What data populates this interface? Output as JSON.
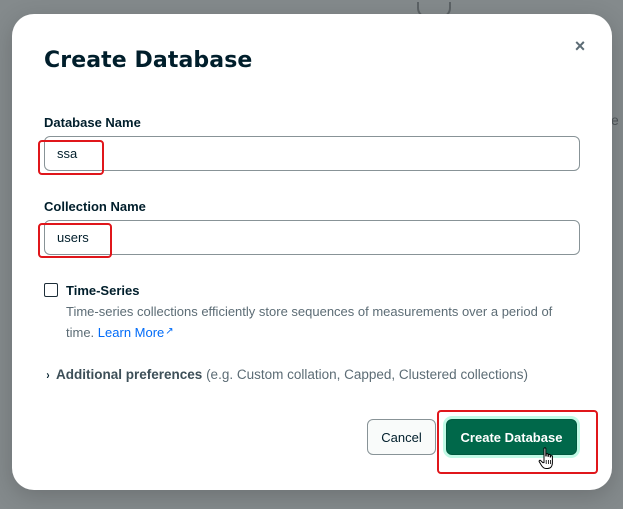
{
  "modal": {
    "title": "Create Database",
    "close_icon": "×"
  },
  "database_name": {
    "label": "Database Name",
    "value": "ssa"
  },
  "collection_name": {
    "label": "Collection Name",
    "value": "users"
  },
  "time_series": {
    "label": "Time-Series",
    "checked": false,
    "description": "Time-series collections efficiently store sequences of measurements over a period of time.",
    "learn_more": "Learn More",
    "external_icon": "↗"
  },
  "additional_preferences": {
    "label": "Additional preferences",
    "hint": "(e.g. Custom collation, Capped, Clustered collections)",
    "chevron": "›"
  },
  "buttons": {
    "cancel": "Cancel",
    "create": "Create Database"
  },
  "colors": {
    "primary": "#00684a",
    "link": "#016bf8",
    "highlight": "#e0161b",
    "text": "#001e2b"
  }
}
